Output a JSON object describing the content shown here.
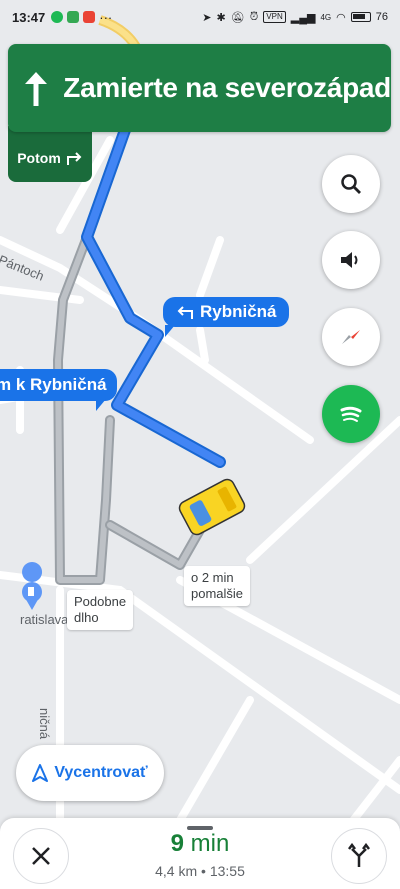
{
  "status_bar": {
    "time": "13:47",
    "vpn": "VPN",
    "network": "4G",
    "battery": "76"
  },
  "navigation": {
    "instruction": "Zamierte na severozápad",
    "then_label": "Potom"
  },
  "map": {
    "street_label_1": "Rybničná",
    "street_label_2": "m k Rybničná",
    "road_pantoch": "Pántoch",
    "road_ratislava": "ratislava",
    "road_rybnicna_vertical": "ničná",
    "alt_route_a": "o 2 min\npomalšie",
    "alt_route_b": "Podobne\ndlho"
  },
  "buttons": {
    "recenter": "Vycentrovať"
  },
  "trip": {
    "duration_value": "9",
    "duration_unit": "min",
    "distance": "4,4 km",
    "arrival": "13:55"
  },
  "colors": {
    "banner": "#1e7e45",
    "route": "#4285f4",
    "accent": "#1a73e8",
    "eta": "#188038"
  }
}
